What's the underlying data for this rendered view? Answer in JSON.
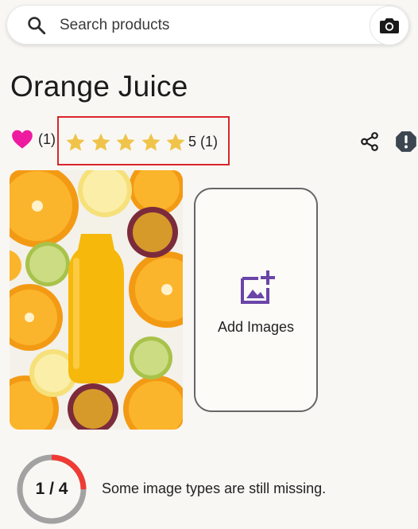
{
  "search": {
    "placeholder": "Search products",
    "search_icon": "search-icon",
    "camera_icon": "camera-icon"
  },
  "product": {
    "title": "Orange Juice"
  },
  "favorites": {
    "count_text": "(1)",
    "icon": "heart-icon",
    "color": "#ee1aa0"
  },
  "rating": {
    "stars": 5,
    "text": "5 (1)",
    "star_color": "#f0c44a",
    "highlight_color": "#d9252a"
  },
  "actions": {
    "share_icon": "share-icon",
    "report_icon": "report-icon"
  },
  "images": {
    "add_label": "Add Images",
    "add_icon": "add-image-icon",
    "accent_color": "#6a45a8"
  },
  "completeness": {
    "progress_text": "1 / 4",
    "done": 1,
    "total": 4,
    "message": "Some image types are still missing.",
    "progress_color": "#ef3b34"
  }
}
